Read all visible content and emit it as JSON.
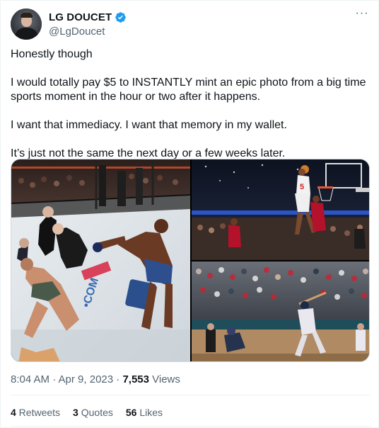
{
  "tweet": {
    "display_name": "LG DOUCET",
    "handle": "@LgDoucet",
    "more_label": "···",
    "verified_icon": "verified-badge-icon",
    "verified_color": "#1d9bf0",
    "paragraphs": [
      "Honestly though",
      "I would totally pay $5 to INSTANTLY mint an epic photo from a big time sports moment in the hour or two after it happens.",
      "I want that immediacy. I want that memory in my wallet.",
      "It’s just not the same the next day or a few weeks later."
    ],
    "timestamp": "8:04 AM · Apr 9, 2023 · ",
    "views_count": "7,553",
    "views_label": " Views",
    "stats": {
      "retweets_count": "4",
      "retweets_label": " Retweets",
      "quotes_count": "3",
      "quotes_label": " Quotes",
      "likes_count": "56",
      "likes_label": " Likes"
    }
  },
  "media": [
    {
      "id": "ufc-fight-photo",
      "kind": "photo"
    },
    {
      "id": "basketball-dunk-photo",
      "kind": "photo"
    },
    {
      "id": "baseball-swing-photo",
      "kind": "photo"
    }
  ]
}
